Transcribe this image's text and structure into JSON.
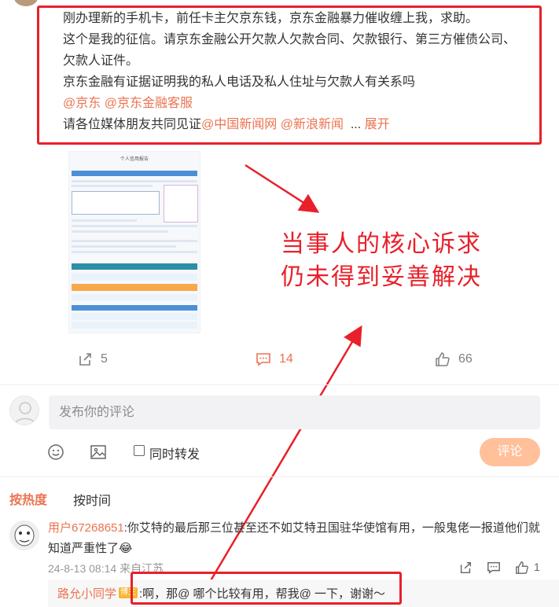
{
  "post": {
    "lines": [
      "刚办理新的手机卡，前任卡主欠京东钱，京东金融暴力催收缠上我，求助。",
      "这个是我的征信。请京东金融公开欠款人欠款合同、欠款银行、第三方催债公司、",
      "欠款人证件。",
      "京东金融有证据证明我的私人电话及私人住址与欠款人有关系吗"
    ],
    "mention_jd": "@京东",
    "mention_jd_service": "@京东金融客服",
    "witness_prefix": "请各位媒体朋友共同见证",
    "mention_china_news": "@中国新闻网",
    "mention_sina_news": "@新浪新闻",
    "ellipsis": "...",
    "expand_label": "展开"
  },
  "credit_report": {
    "title": "个人信用报告"
  },
  "annotation": {
    "line1": "当事人的核心诉求",
    "line2": "仍未得到妥善解决"
  },
  "actions": {
    "share_count": "5",
    "comment_count": "14",
    "like_count": "66"
  },
  "composer": {
    "placeholder": "发布你的评论",
    "repost_label": "同时转发",
    "submit_label": "评论"
  },
  "sort": {
    "hot_label": "按热度",
    "time_label": "按时间"
  },
  "comment": {
    "username": "用户67268651",
    "text_line1": ":你艾特的最后那三位甚至还不如艾特丑国驻华使馆有用，一般鬼佬一报道他们就",
    "text_line2": "知道严重性了",
    "emoji": "😂",
    "meta": "24-8-13 08:14 来自江苏",
    "likes": "1"
  },
  "reply": {
    "username": "路允小同学",
    "badge": "博主",
    "text": ":啊，那@ 哪个比较有用，帮我@ 一下，谢谢～"
  },
  "colors": {
    "accent": "#eb7350",
    "annotation_red": "#e8202a",
    "button_disabled": "#ffc09a"
  }
}
